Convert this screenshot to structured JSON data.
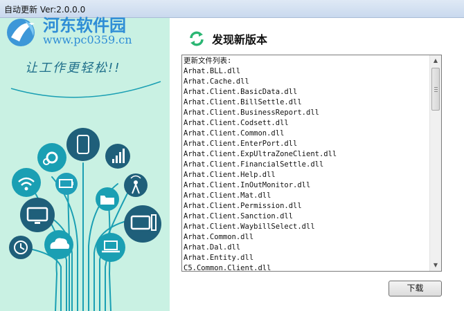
{
  "window": {
    "title": "自动更新 Ver:2.0.0.0"
  },
  "watermark": {
    "site_name": "河东软件园",
    "url": "www.pc0359.cn"
  },
  "left_panel": {
    "slogan": "让工作更轻松!!"
  },
  "header": {
    "title": "发现新版本",
    "icon": "refresh-icon"
  },
  "update_list": {
    "items": [
      "更新文件列表:",
      "Arhat.BLL.dll",
      "Arhat.Cache.dll",
      "Arhat.Client.BasicData.dll",
      "Arhat.Client.BillSettle.dll",
      "Arhat.Client.BusinessReport.dll",
      "Arhat.Client.Codsett.dll",
      "Arhat.Client.Common.dll",
      "Arhat.Client.EnterPort.dll",
      "Arhat.Client.ExpUltraZoneClient.dll",
      "Arhat.Client.FinancialSettle.dll",
      "Arhat.Client.Help.dll",
      "Arhat.Client.InOutMonitor.dll",
      "Arhat.Client.Mat.dll",
      "Arhat.Client.Permission.dll",
      "Arhat.Client.Sanction.dll",
      "Arhat.Client.WaybillSelect.dll",
      "Arhat.Common.dll",
      "Arhat.Dal.dll",
      "Arhat.Entity.dll",
      "C5.Common.Client.dll"
    ]
  },
  "buttons": {
    "download": "下载"
  },
  "colors": {
    "accent": "#2e8dd6",
    "panel_bg": "#c9f1e3",
    "tree": "#1a9fb3",
    "refresh": "#2bb673"
  }
}
